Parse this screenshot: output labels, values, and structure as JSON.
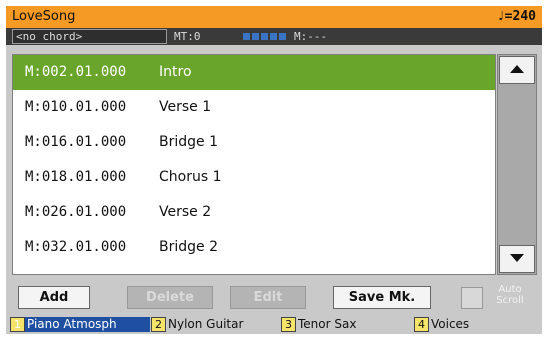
{
  "title_bar": {
    "song_name": "LoveSong",
    "tempo": "♩=240"
  },
  "status_bar": {
    "chord": "<no chord>",
    "mt": "MT:0",
    "measure": "M:---"
  },
  "markers": [
    {
      "time": "M:002.01.000",
      "name": "Intro",
      "selected": true
    },
    {
      "time": "M:010.01.000",
      "name": "Verse 1",
      "selected": false
    },
    {
      "time": "M:016.01.000",
      "name": "Bridge 1",
      "selected": false
    },
    {
      "time": "M:018.01.000",
      "name": "Chorus 1",
      "selected": false
    },
    {
      "time": "M:026.01.000",
      "name": "Verse 2",
      "selected": false
    },
    {
      "time": "M:032.01.000",
      "name": "Bridge 2",
      "selected": false
    }
  ],
  "buttons": {
    "add": "Add",
    "delete": "Delete",
    "edit": "Edit",
    "save_mk": "Save Mk.",
    "auto_scroll_line1": "Auto",
    "auto_scroll_line2": "Scroll"
  },
  "tracks": [
    {
      "num": "1",
      "name": "Piano Atmosph",
      "active": true
    },
    {
      "num": "2",
      "name": "Nylon Guitar",
      "active": false
    },
    {
      "num": "3",
      "name": "Tenor Sax",
      "active": false
    },
    {
      "num": "4",
      "name": "Voices",
      "active": false
    }
  ],
  "colors": {
    "title_bar": "#f59a24",
    "selected_row": "#6aa52b",
    "active_track": "#1e4fa0"
  }
}
